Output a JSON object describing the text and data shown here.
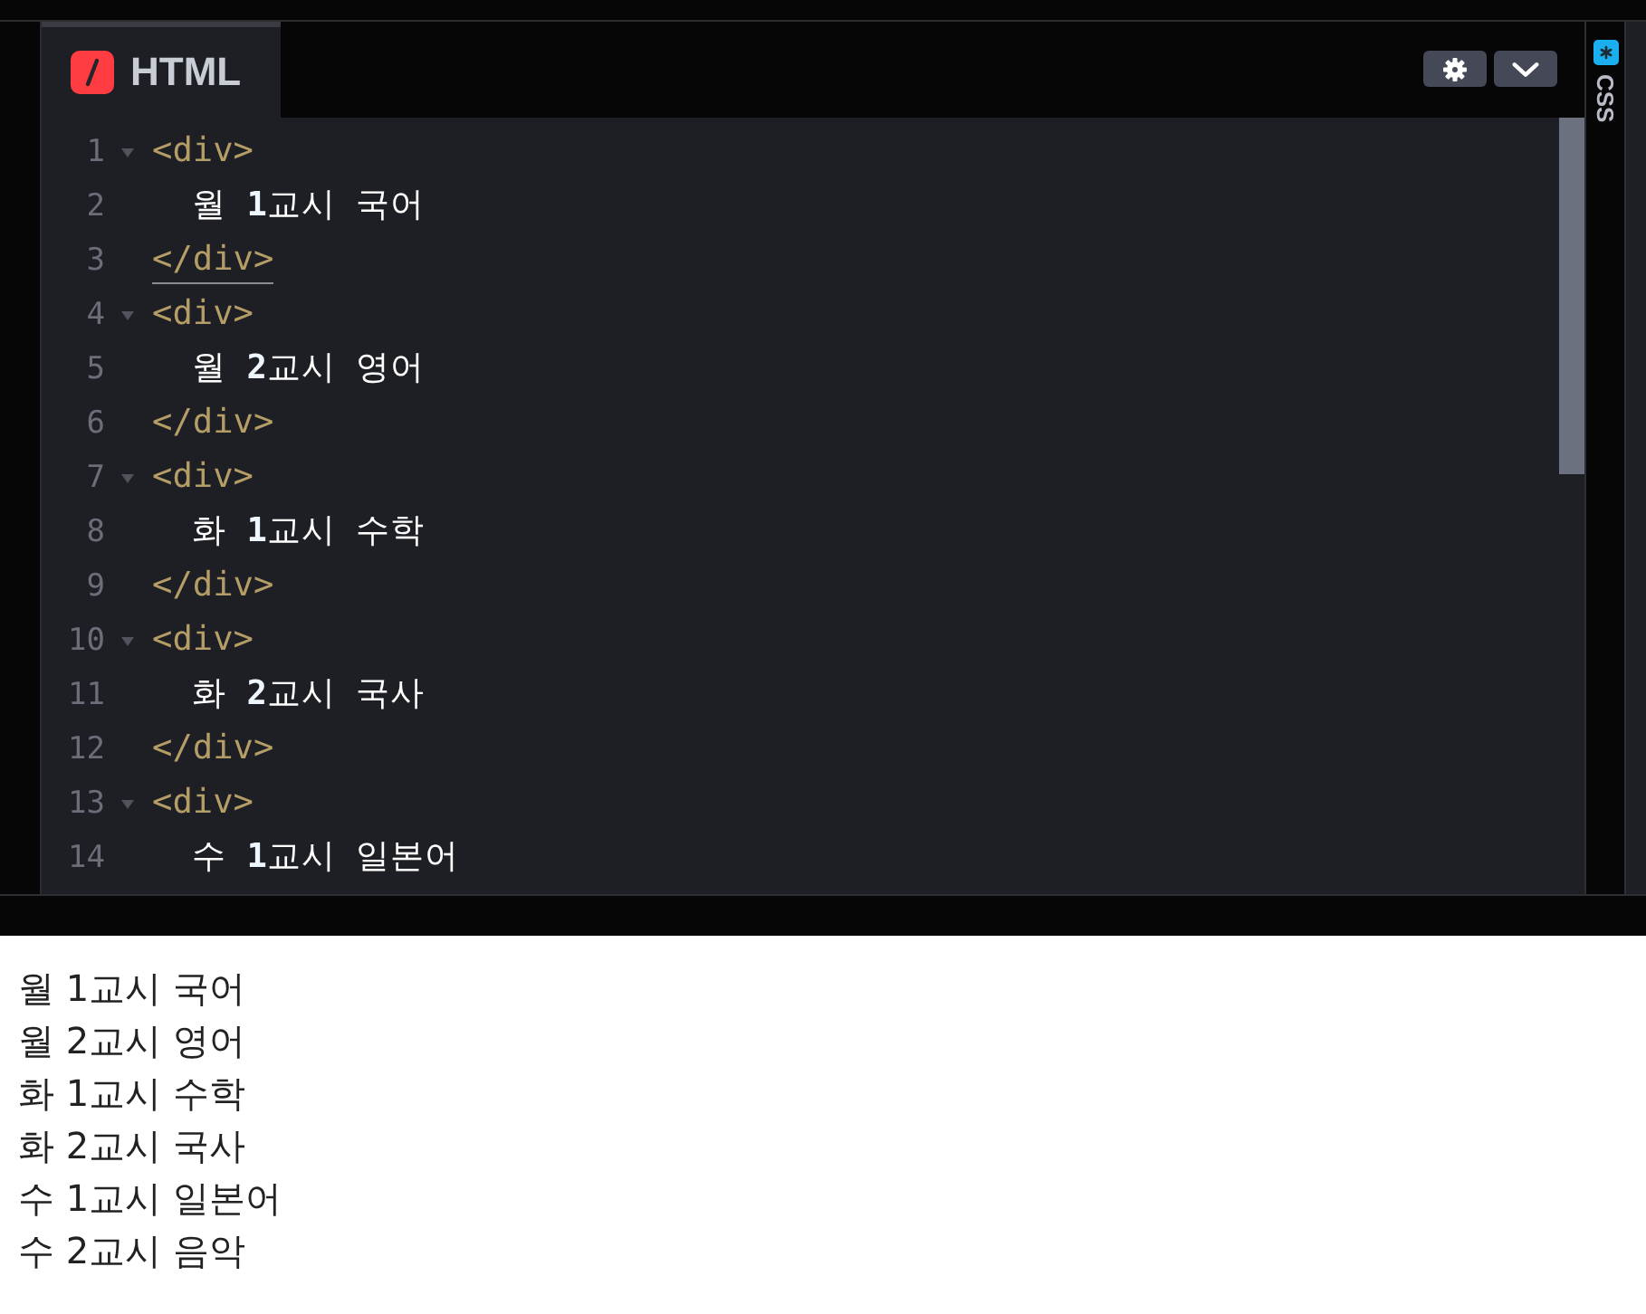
{
  "editor": {
    "tab": {
      "label": "HTML",
      "selected": true
    },
    "toolbar": [
      {
        "kind": "settings"
      },
      {
        "kind": "collapse"
      }
    ],
    "lines": [
      {
        "number": "1",
        "kind": "open",
        "text": "<div>",
        "matched": false
      },
      {
        "number": "2",
        "kind": "text",
        "text": "월 **1**교시 국어",
        "matched": false
      },
      {
        "number": "3",
        "kind": "close",
        "text": "</div>",
        "matched": true
      },
      {
        "number": "4",
        "kind": "open",
        "text": "<div>",
        "matched": false
      },
      {
        "number": "5",
        "kind": "text",
        "text": "월 **2**교시 영어",
        "matched": false
      },
      {
        "number": "6",
        "kind": "close",
        "text": "</div>",
        "matched": false
      },
      {
        "number": "7",
        "kind": "open",
        "text": "<div>",
        "matched": false
      },
      {
        "number": "8",
        "kind": "text",
        "text": "화 **1**교시 수학",
        "matched": false
      },
      {
        "number": "9",
        "kind": "close",
        "text": "</div>",
        "matched": false
      },
      {
        "number": "10",
        "kind": "open",
        "text": "<div>",
        "matched": false
      },
      {
        "number": "11",
        "kind": "text",
        "text": "화 **2**교시 국사",
        "matched": false
      },
      {
        "number": "12",
        "kind": "close",
        "text": "</div>",
        "matched": false
      },
      {
        "number": "13",
        "kind": "open",
        "text": "<div>",
        "matched": false
      },
      {
        "number": "14",
        "kind": "text",
        "text": "수 **1**교시 일본어",
        "matched": false
      }
    ]
  },
  "side_tab": {
    "label": "CSS",
    "selected": false
  },
  "output": {
    "lines": [
      "월 1교시 국어",
      "월 2교시 영어",
      "화 1교시 수학",
      "화 2교시 국사",
      "수 1교시 일본어",
      "수 2교시 음악"
    ]
  }
}
